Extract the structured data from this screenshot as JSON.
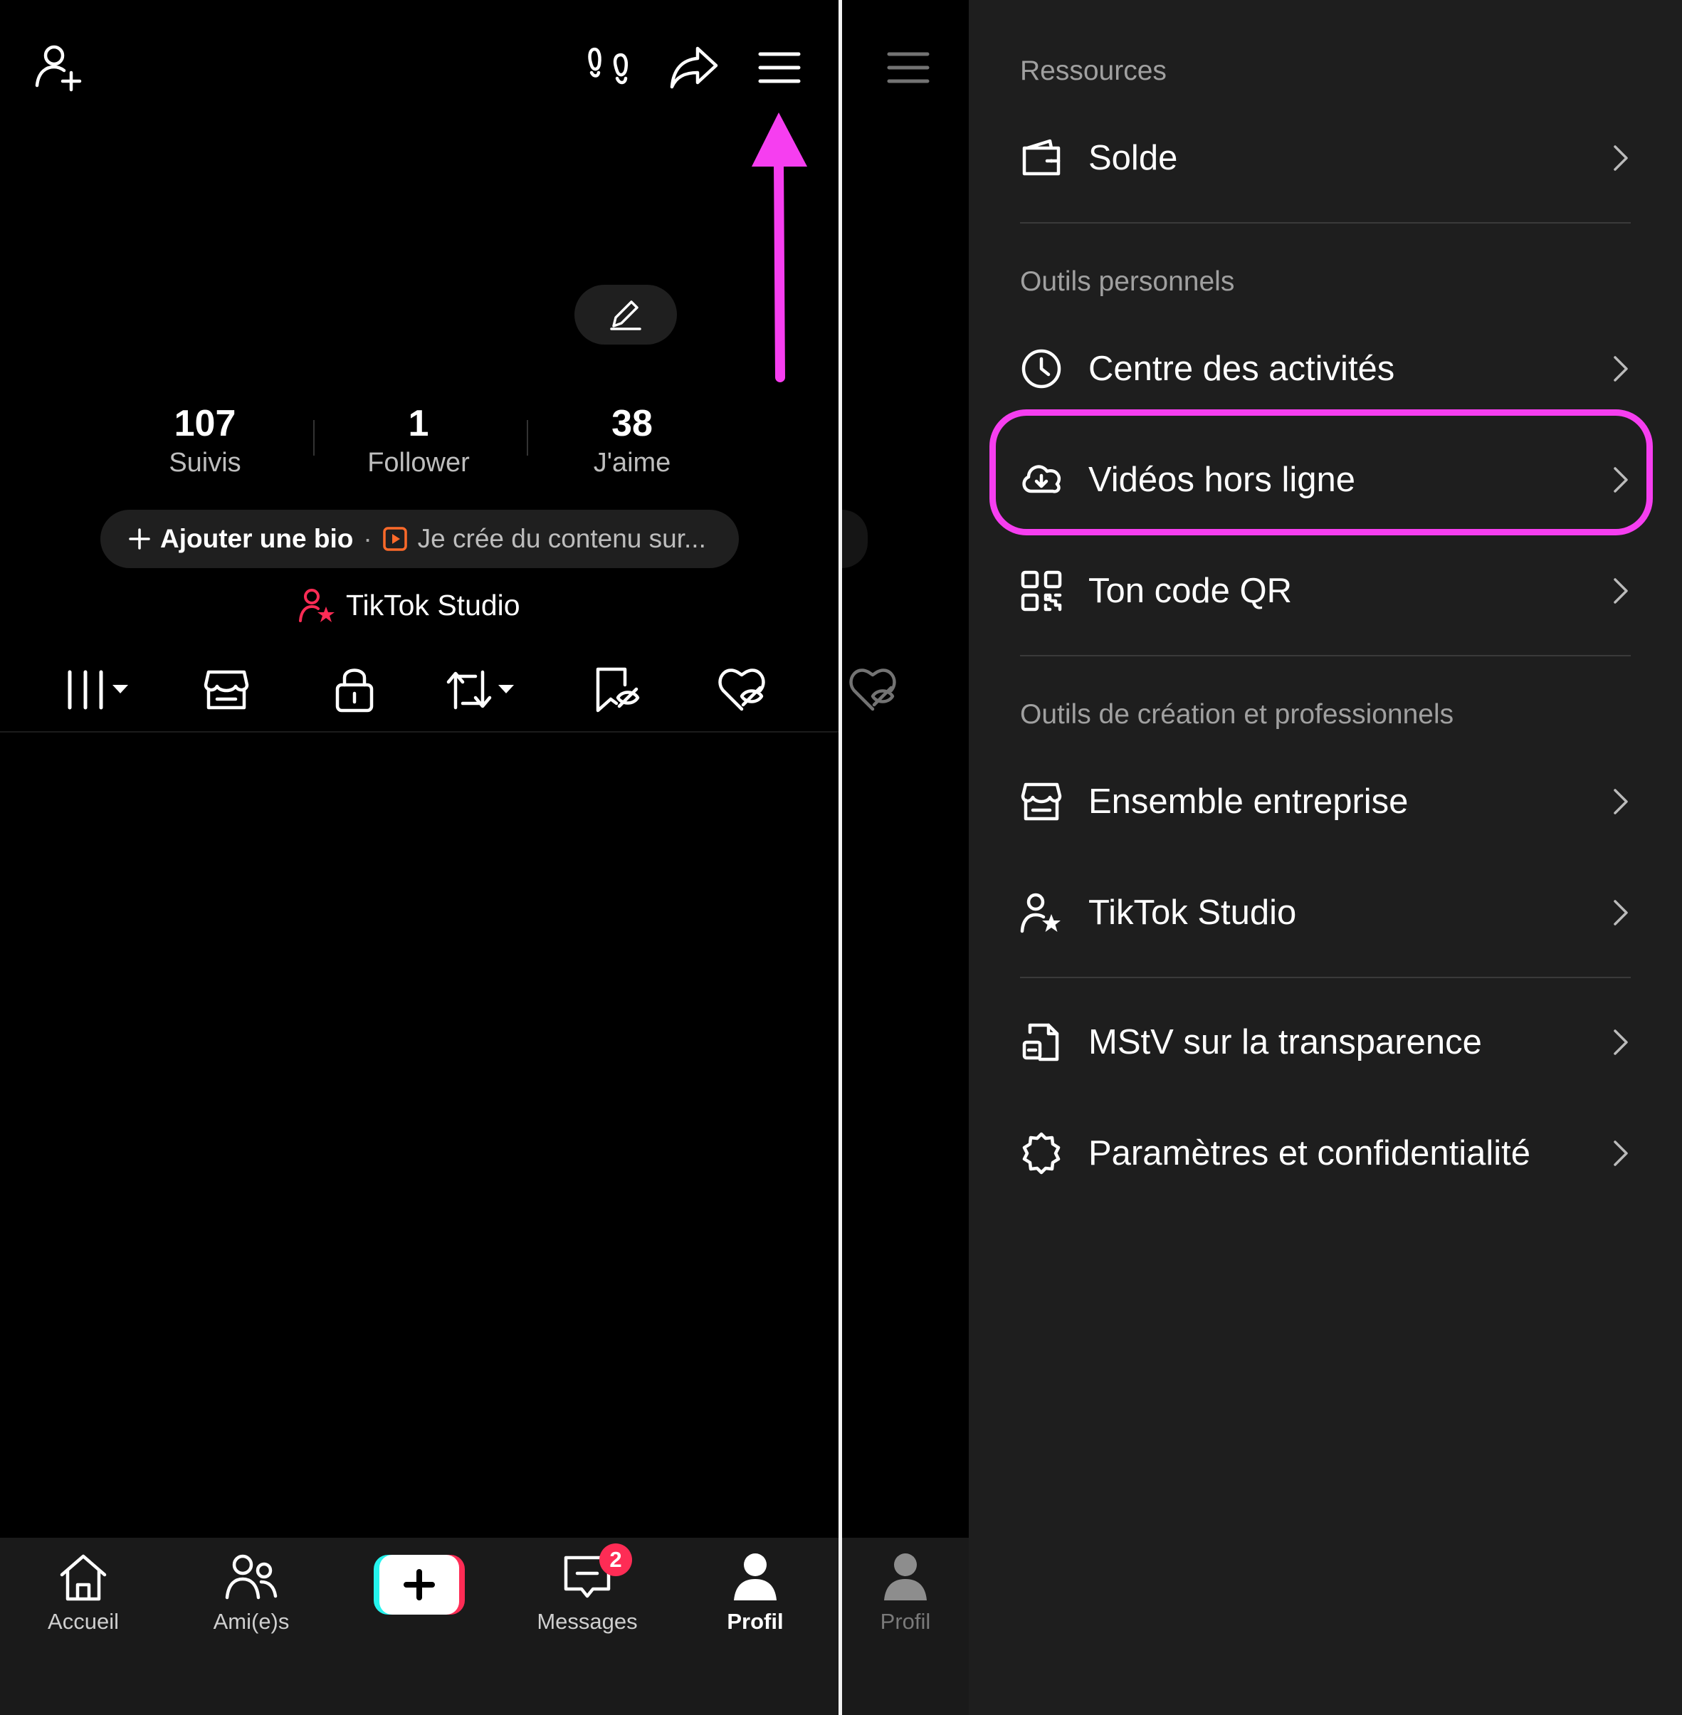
{
  "colors": {
    "accent_magenta": "#f63ef0",
    "tiktok_red": "#fe2c55",
    "tiktok_cyan": "#25f4ee",
    "bg_panel": "#1e1e1e"
  },
  "profile": {
    "stats": [
      {
        "value": "107",
        "label": "Suivis"
      },
      {
        "value": "1",
        "label": "Follower"
      },
      {
        "value": "38",
        "label": "J'aime"
      }
    ],
    "bio_add": "Ajouter une bio",
    "bio_separator": "·",
    "bio_category": "Je crée du contenu sur...",
    "studio_link": "TikTok Studio"
  },
  "header_icons": [
    "add-friend-icon",
    "footprints-icon",
    "share-icon",
    "menu-icon"
  ],
  "content_tabs": [
    "videos-grid-icon",
    "shop-icon",
    "lock-icon",
    "repost-icon",
    "bookmark-hidden-icon",
    "liked-hidden-icon"
  ],
  "bottom_nav": {
    "items": [
      {
        "label": "Accueil",
        "icon": "home-icon"
      },
      {
        "label": "Ami(e)s",
        "icon": "friends-icon"
      },
      {
        "label": "",
        "icon": "plus-icon"
      },
      {
        "label": "Messages",
        "icon": "inbox-icon",
        "badge": "2"
      },
      {
        "label": "Profil",
        "icon": "profile-icon",
        "active": true
      }
    ],
    "middle_profile_label": "Profil"
  },
  "menu": {
    "sections": [
      {
        "title": "Ressources",
        "items": [
          {
            "label": "Solde",
            "icon": "wallet-icon"
          }
        ]
      },
      {
        "title": "Outils personnels",
        "items": [
          {
            "label": "Centre des activités",
            "icon": "clock-icon"
          },
          {
            "label": "Vidéos hors ligne",
            "icon": "cloud-download-icon",
            "highlighted": true
          },
          {
            "label": "Ton code QR",
            "icon": "qr-code-icon"
          }
        ]
      },
      {
        "title": "Outils de création et professionnels",
        "items": [
          {
            "label": "Ensemble entreprise",
            "icon": "shop-icon"
          },
          {
            "label": "TikTok Studio",
            "icon": "creator-star-icon"
          }
        ]
      },
      {
        "title": "",
        "items": [
          {
            "label": "MStV sur la transparence",
            "icon": "document-icon"
          },
          {
            "label": "Paramètres et confidentialité",
            "icon": "settings-icon"
          }
        ]
      }
    ]
  }
}
